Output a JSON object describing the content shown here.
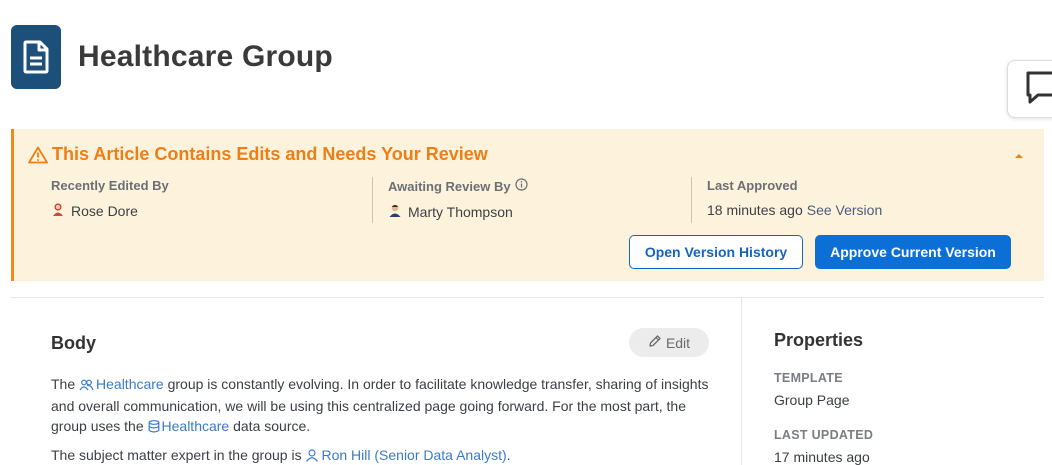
{
  "header": {
    "title": "Healthcare Group"
  },
  "banner": {
    "title": "This Article Contains Edits and Needs Your Review",
    "recently_edited": {
      "label": "Recently Edited By",
      "user": "Rose Dore"
    },
    "awaiting_review": {
      "label": "Awaiting Review By",
      "user": "Marty Thompson"
    },
    "last_approved": {
      "label": "Last Approved",
      "time": "18 minutes ago",
      "link": "See Version"
    },
    "open_history_label": "Open Version History",
    "approve_label": "Approve Current Version"
  },
  "body": {
    "heading": "Body",
    "edit_label": "Edit",
    "p1_pre": "The ",
    "p1_group": "Healthcare",
    "p1_mid": " group is constantly evolving. In order to facilitate knowledge transfer, sharing of insights and overall communication, we will be using this centralized page going forward. For the most part, the group uses the ",
    "p1_source": "Healthcare",
    "p1_post": " data source.",
    "p2_pre": "The subject matter expert in the group is ",
    "p2_person": "Ron Hill (Senior Data Analyst)",
    "p2_post": "."
  },
  "properties": {
    "heading": "Properties",
    "template_label": "TEMPLATE",
    "template_value": "Group Page",
    "updated_label": "LAST UPDATED",
    "updated_value": "17 minutes ago"
  },
  "colors": {
    "brand": "#1c4f7a",
    "warning": "#ef7e14",
    "primary": "#0b6fd6",
    "link": "#3a7bc8"
  },
  "icons": [
    "document-icon",
    "chat-icon",
    "warning-icon",
    "chevron-up-icon",
    "info-icon",
    "pencil-icon",
    "group-icon",
    "database-icon",
    "user-icon"
  ]
}
